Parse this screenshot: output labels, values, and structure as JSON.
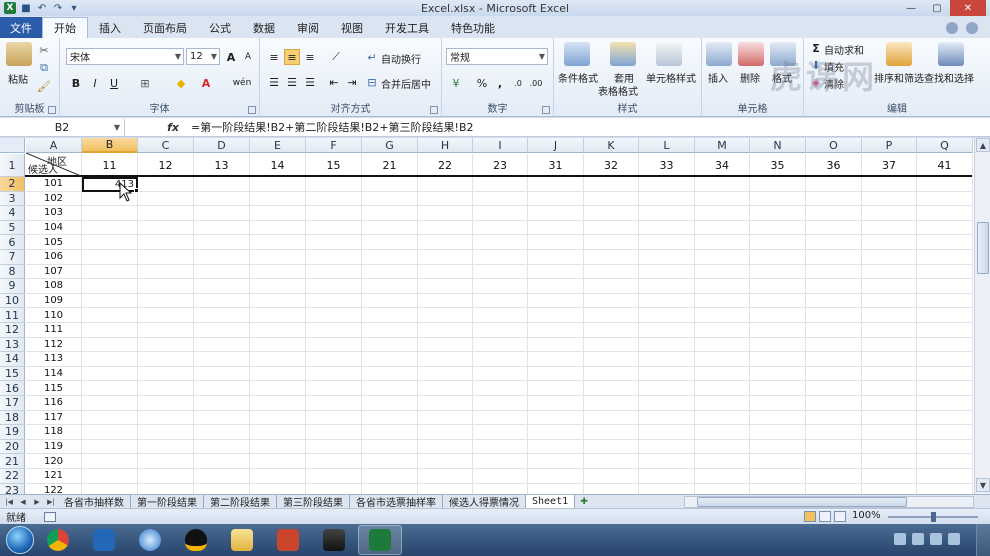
{
  "window": {
    "title": "Excel.xlsx - Microsoft Excel",
    "app_logo": "X"
  },
  "tabs": {
    "file": "文件",
    "items": [
      "开始",
      "插入",
      "页面布局",
      "公式",
      "数据",
      "审阅",
      "视图",
      "开发工具",
      "特色功能"
    ],
    "active": "开始"
  },
  "ribbon": {
    "clipboard": {
      "label": "剪贴板",
      "paste": "粘贴"
    },
    "font": {
      "label": "字体",
      "name": "宋体",
      "size": "12",
      "bold": "B",
      "italic": "I",
      "underline": "U",
      "grow": "A",
      "shrink": "A",
      "wen": "wén"
    },
    "alignment": {
      "label": "对齐方式",
      "wrap": "自动换行",
      "merge": "合并后居中"
    },
    "number": {
      "label": "数字",
      "format": "常规",
      "percent": "%",
      "comma": ","
    },
    "styles": {
      "label": "样式",
      "conditional": "条件格式",
      "table": "套用\n表格格式",
      "table_line1": "套用",
      "table_line2": "表格格式",
      "cell": "单元格样式"
    },
    "cells": {
      "label": "单元格",
      "insert": "插入",
      "delete": "删除",
      "format": "格式"
    },
    "editing": {
      "label": "编辑",
      "autosum": "自动求和",
      "fill": "填充",
      "clear": "清除",
      "sort": "排序和筛选",
      "find": "查找和选择"
    }
  },
  "formula_bar": {
    "name_box": "B2",
    "fx": "fx",
    "formula": "=第一阶段结果!B2+第二阶段结果!B2+第三阶段结果!B2"
  },
  "sheet": {
    "columns": [
      "A",
      "B",
      "C",
      "D",
      "E",
      "F",
      "G",
      "H",
      "I",
      "J",
      "K",
      "L",
      "M",
      "N",
      "O",
      "P",
      "Q"
    ],
    "selected_column": "B",
    "header_row": {
      "diag_top": "地区",
      "diag_bottom": "候选人",
      "region_codes": [
        "11",
        "12",
        "13",
        "14",
        "15",
        "21",
        "22",
        "23",
        "31",
        "32",
        "33",
        "34",
        "35",
        "36",
        "37",
        "41"
      ]
    },
    "row_numbers": [
      "1",
      "2",
      "3",
      "4",
      "5",
      "6",
      "7",
      "8",
      "9",
      "10",
      "11",
      "12",
      "13",
      "14",
      "15",
      "16",
      "17",
      "18",
      "19",
      "20",
      "21",
      "22",
      "23"
    ],
    "candidates": [
      "101",
      "102",
      "103",
      "104",
      "105",
      "106",
      "107",
      "108",
      "109",
      "110",
      "111",
      "112",
      "113",
      "114",
      "115",
      "116",
      "117",
      "118",
      "119",
      "120",
      "121",
      "122"
    ],
    "active_cell": {
      "ref": "B2",
      "value": "413"
    }
  },
  "sheet_tabs": {
    "items": [
      "各省市抽样数",
      "第一阶段结果",
      "第二阶段结果",
      "第三阶段结果",
      "各省市选票抽样率",
      "候选人得票情况",
      "Sheet1"
    ],
    "active": "Sheet1"
  },
  "status": {
    "mode": "就绪",
    "zoom": "100%",
    "zoom_fraction": 0.5
  },
  "watermark": "虎课网",
  "colors": {
    "accent": "#2a5caa",
    "selection": "#f1c15f",
    "excel_green": "#1d7a3a"
  }
}
